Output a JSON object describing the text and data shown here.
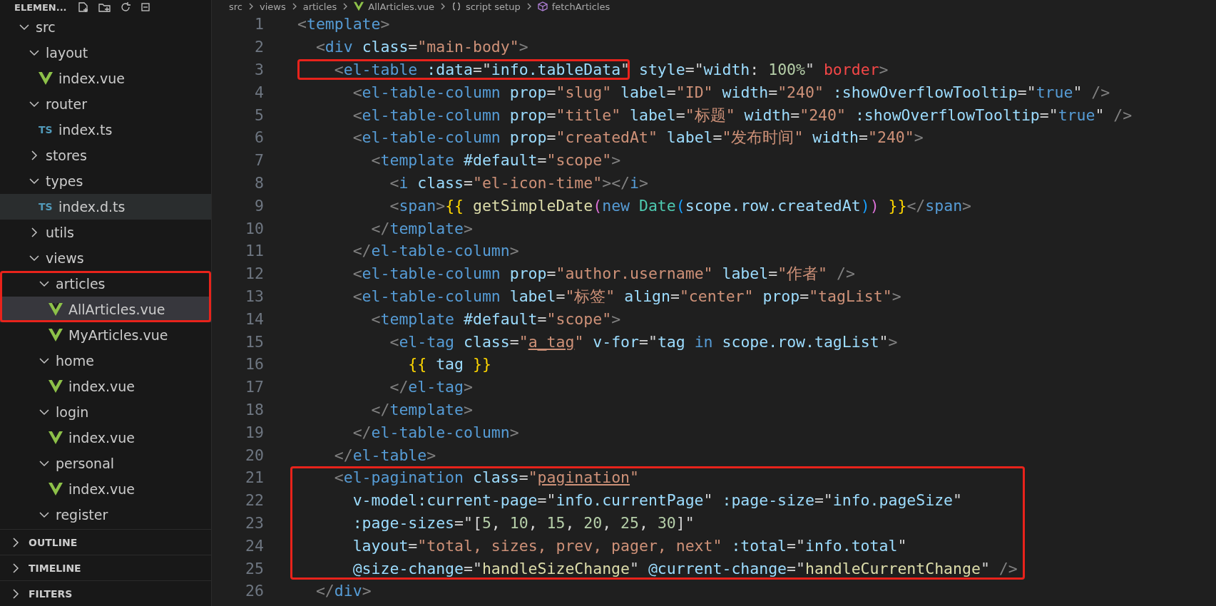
{
  "explorer": {
    "title": "ELEMEN...",
    "tree": [
      {
        "label": "src",
        "kind": "folder",
        "expanded": true,
        "selected": false,
        "hovered": false,
        "boxed": false,
        "children": [
          {
            "label": "layout",
            "kind": "folder",
            "expanded": true,
            "selected": false,
            "hovered": false,
            "boxed": false,
            "children": [
              {
                "label": "index.vue",
                "kind": "vue",
                "selected": false,
                "hovered": false,
                "boxed": false
              }
            ]
          },
          {
            "label": "router",
            "kind": "folder",
            "expanded": true,
            "selected": false,
            "hovered": false,
            "boxed": false,
            "children": [
              {
                "label": "index.ts",
                "kind": "ts",
                "icon_text": "TS",
                "selected": false,
                "hovered": false,
                "boxed": false
              }
            ]
          },
          {
            "label": "stores",
            "kind": "folder",
            "expanded": false,
            "selected": false,
            "hovered": false,
            "boxed": false
          },
          {
            "label": "types",
            "kind": "folder",
            "expanded": true,
            "selected": false,
            "hovered": false,
            "boxed": false,
            "children": [
              {
                "label": "index.d.ts",
                "kind": "ts",
                "icon_text": "TS",
                "selected": false,
                "hovered": true,
                "boxed": false
              }
            ]
          },
          {
            "label": "utils",
            "kind": "folder",
            "expanded": false,
            "selected": false,
            "hovered": false,
            "boxed": false
          },
          {
            "label": "views",
            "kind": "folder",
            "expanded": true,
            "selected": false,
            "hovered": false,
            "boxed": false,
            "children": [
              {
                "label": "articles",
                "kind": "folder",
                "expanded": true,
                "selected": false,
                "hovered": false,
                "boxed": true,
                "children": [
                  {
                    "label": "AllArticles.vue",
                    "kind": "vue",
                    "selected": true,
                    "hovered": false,
                    "boxed": true
                  },
                  {
                    "label": "MyArticles.vue",
                    "kind": "vue",
                    "selected": false,
                    "hovered": false,
                    "boxed": false
                  }
                ]
              },
              {
                "label": "home",
                "kind": "folder",
                "expanded": true,
                "selected": false,
                "hovered": false,
                "boxed": false,
                "children": [
                  {
                    "label": "index.vue",
                    "kind": "vue",
                    "selected": false,
                    "hovered": false,
                    "boxed": false
                  }
                ]
              },
              {
                "label": "login",
                "kind": "folder",
                "expanded": true,
                "selected": false,
                "hovered": false,
                "boxed": false,
                "children": [
                  {
                    "label": "index.vue",
                    "kind": "vue",
                    "selected": false,
                    "hovered": false,
                    "boxed": false
                  }
                ]
              },
              {
                "label": "personal",
                "kind": "folder",
                "expanded": true,
                "selected": false,
                "hovered": false,
                "boxed": false,
                "children": [
                  {
                    "label": "index.vue",
                    "kind": "vue",
                    "selected": false,
                    "hovered": false,
                    "boxed": false
                  }
                ]
              },
              {
                "label": "register",
                "kind": "folder",
                "expanded": true,
                "selected": false,
                "hovered": false,
                "boxed": false
              }
            ]
          }
        ]
      }
    ]
  },
  "panels": [
    {
      "label": "OUTLINE",
      "expanded": false
    },
    {
      "label": "TIMELINE",
      "expanded": false
    },
    {
      "label": "FILTERS",
      "expanded": false
    }
  ],
  "breadcrumb": [
    {
      "label": "src",
      "kind": "folder"
    },
    {
      "label": "views",
      "kind": "folder"
    },
    {
      "label": "articles",
      "kind": "folder"
    },
    {
      "label": "AllArticles.vue",
      "kind": "vue"
    },
    {
      "label": "script setup",
      "kind": "braces"
    },
    {
      "label": "fetchArticles",
      "kind": "method"
    }
  ],
  "code": {
    "lines": [
      {
        "number": "1",
        "boxed": false,
        "tokens": [
          {
            "kind": "p",
            "text": "<"
          },
          {
            "kind": "tag",
            "text": "template"
          },
          {
            "kind": "p",
            "text": ">"
          }
        ]
      },
      {
        "number": "2",
        "boxed": false,
        "tokens": [
          {
            "kind": "p",
            "text": "  <"
          },
          {
            "kind": "tag",
            "text": "div"
          },
          {
            "kind": "attr",
            "text": " class"
          },
          {
            "kind": "op",
            "text": "="
          },
          {
            "kind": "str",
            "text": "\"main-body\""
          },
          {
            "kind": "p",
            "text": ">"
          }
        ]
      },
      {
        "number": "3",
        "boxed": false,
        "tokens": [
          {
            "kind": "group",
            "boxed": true,
            "tokens": [
              {
                "kind": "p",
                "text": "    <"
              },
              {
                "kind": "tag",
                "text": "el-table"
              },
              {
                "kind": "attr",
                "text": " :data"
              },
              {
                "kind": "op",
                "text": "=\""
              },
              {
                "kind": "js",
                "text": "info.tableData"
              },
              {
                "kind": "op",
                "text": "\""
              }
            ]
          },
          {
            "kind": "attr",
            "text": " style"
          },
          {
            "kind": "op",
            "text": "=\""
          },
          {
            "kind": "cssp",
            "text": "width"
          },
          {
            "kind": "op",
            "text": ":"
          },
          {
            "kind": "num",
            "text": " 100%"
          },
          {
            "kind": "op",
            "text": "\""
          },
          {
            "kind": "err",
            "text": " border"
          },
          {
            "kind": "p",
            "text": ">"
          }
        ]
      },
      {
        "number": "4",
        "boxed": false,
        "tokens": [
          {
            "kind": "p",
            "text": "      <"
          },
          {
            "kind": "tag",
            "text": "el-table-column"
          },
          {
            "kind": "attr",
            "text": " prop"
          },
          {
            "kind": "op",
            "text": "="
          },
          {
            "kind": "str",
            "text": "\"slug\""
          },
          {
            "kind": "attr",
            "text": " label"
          },
          {
            "kind": "op",
            "text": "="
          },
          {
            "kind": "str",
            "text": "\"ID\""
          },
          {
            "kind": "attr",
            "text": " width"
          },
          {
            "kind": "op",
            "text": "="
          },
          {
            "kind": "str",
            "text": "\"240\""
          },
          {
            "kind": "attr",
            "text": " :showOverflowTooltip"
          },
          {
            "kind": "op",
            "text": "=\""
          },
          {
            "kind": "kw",
            "text": "true"
          },
          {
            "kind": "op",
            "text": "\""
          },
          {
            "kind": "p",
            "text": " />"
          }
        ]
      },
      {
        "number": "5",
        "boxed": false,
        "tokens": [
          {
            "kind": "p",
            "text": "      <"
          },
          {
            "kind": "tag",
            "text": "el-table-column"
          },
          {
            "kind": "attr",
            "text": " prop"
          },
          {
            "kind": "op",
            "text": "="
          },
          {
            "kind": "str",
            "text": "\"title\""
          },
          {
            "kind": "attr",
            "text": " label"
          },
          {
            "kind": "op",
            "text": "="
          },
          {
            "kind": "str",
            "text": "\"标题\""
          },
          {
            "kind": "attr",
            "text": " width"
          },
          {
            "kind": "op",
            "text": "="
          },
          {
            "kind": "str",
            "text": "\"240\""
          },
          {
            "kind": "attr",
            "text": " :showOverflowTooltip"
          },
          {
            "kind": "op",
            "text": "=\""
          },
          {
            "kind": "kw",
            "text": "true"
          },
          {
            "kind": "op",
            "text": "\""
          },
          {
            "kind": "p",
            "text": " />"
          }
        ]
      },
      {
        "number": "6",
        "boxed": false,
        "tokens": [
          {
            "kind": "p",
            "text": "      <"
          },
          {
            "kind": "tag",
            "text": "el-table-column"
          },
          {
            "kind": "attr",
            "text": " prop"
          },
          {
            "kind": "op",
            "text": "="
          },
          {
            "kind": "str",
            "text": "\"createdAt\""
          },
          {
            "kind": "attr",
            "text": " label"
          },
          {
            "kind": "op",
            "text": "="
          },
          {
            "kind": "str",
            "text": "\"发布时间\""
          },
          {
            "kind": "attr",
            "text": " width"
          },
          {
            "kind": "op",
            "text": "="
          },
          {
            "kind": "str",
            "text": "\"240\""
          },
          {
            "kind": "p",
            "text": ">"
          }
        ]
      },
      {
        "number": "7",
        "boxed": false,
        "tokens": [
          {
            "kind": "p",
            "text": "        <"
          },
          {
            "kind": "tag",
            "text": "template"
          },
          {
            "kind": "attr",
            "text": " #default"
          },
          {
            "kind": "op",
            "text": "="
          },
          {
            "kind": "str",
            "text": "\"scope\""
          },
          {
            "kind": "p",
            "text": ">"
          }
        ]
      },
      {
        "number": "8",
        "boxed": false,
        "tokens": [
          {
            "kind": "p",
            "text": "          <"
          },
          {
            "kind": "tag",
            "text": "i"
          },
          {
            "kind": "attr",
            "text": " class"
          },
          {
            "kind": "op",
            "text": "="
          },
          {
            "kind": "str",
            "text": "\"el-icon-time\""
          },
          {
            "kind": "p",
            "text": "></"
          },
          {
            "kind": "tag",
            "text": "i"
          },
          {
            "kind": "p",
            "text": ">"
          }
        ]
      },
      {
        "number": "9",
        "boxed": false,
        "tokens": [
          {
            "kind": "p",
            "text": "          <"
          },
          {
            "kind": "tag",
            "text": "span"
          },
          {
            "kind": "p",
            "text": ">"
          },
          {
            "kind": "brace",
            "text": "{{"
          },
          {
            "kind": "fn",
            "text": " getSimpleDate"
          },
          {
            "kind": "paren1",
            "text": "("
          },
          {
            "kind": "kw",
            "text": "new"
          },
          {
            "kind": "cls",
            "text": " Date"
          },
          {
            "kind": "paren2",
            "text": "("
          },
          {
            "kind": "js",
            "text": "scope.row.createdAt"
          },
          {
            "kind": "paren2",
            "text": ")"
          },
          {
            "kind": "paren1",
            "text": ")"
          },
          {
            "kind": "brace",
            "text": " }}"
          },
          {
            "kind": "p",
            "text": "</"
          },
          {
            "kind": "tag",
            "text": "span"
          },
          {
            "kind": "p",
            "text": ">"
          }
        ]
      },
      {
        "number": "10",
        "boxed": false,
        "tokens": [
          {
            "kind": "p",
            "text": "        </"
          },
          {
            "kind": "tag",
            "text": "template"
          },
          {
            "kind": "p",
            "text": ">"
          }
        ]
      },
      {
        "number": "11",
        "boxed": false,
        "tokens": [
          {
            "kind": "p",
            "text": "      </"
          },
          {
            "kind": "tag",
            "text": "el-table-column"
          },
          {
            "kind": "p",
            "text": ">"
          }
        ]
      },
      {
        "number": "12",
        "boxed": false,
        "tokens": [
          {
            "kind": "p",
            "text": "      <"
          },
          {
            "kind": "tag",
            "text": "el-table-column"
          },
          {
            "kind": "attr",
            "text": " prop"
          },
          {
            "kind": "op",
            "text": "="
          },
          {
            "kind": "str",
            "text": "\"author.username\""
          },
          {
            "kind": "attr",
            "text": " label"
          },
          {
            "kind": "op",
            "text": "="
          },
          {
            "kind": "str",
            "text": "\"作者\""
          },
          {
            "kind": "p",
            "text": " />"
          }
        ]
      },
      {
        "number": "13",
        "boxed": false,
        "tokens": [
          {
            "kind": "p",
            "text": "      <"
          },
          {
            "kind": "tag",
            "text": "el-table-column"
          },
          {
            "kind": "attr",
            "text": " label"
          },
          {
            "kind": "op",
            "text": "="
          },
          {
            "kind": "str",
            "text": "\"标签\""
          },
          {
            "kind": "attr",
            "text": " align"
          },
          {
            "kind": "op",
            "text": "="
          },
          {
            "kind": "str",
            "text": "\"center\""
          },
          {
            "kind": "attr",
            "text": " prop"
          },
          {
            "kind": "op",
            "text": "="
          },
          {
            "kind": "str",
            "text": "\"tagList\""
          },
          {
            "kind": "p",
            "text": ">"
          }
        ]
      },
      {
        "number": "14",
        "boxed": false,
        "tokens": [
          {
            "kind": "p",
            "text": "        <"
          },
          {
            "kind": "tag",
            "text": "template"
          },
          {
            "kind": "attr",
            "text": " #default"
          },
          {
            "kind": "op",
            "text": "="
          },
          {
            "kind": "str",
            "text": "\"scope\""
          },
          {
            "kind": "p",
            "text": ">"
          }
        ]
      },
      {
        "number": "15",
        "boxed": false,
        "tokens": [
          {
            "kind": "p",
            "text": "          <"
          },
          {
            "kind": "tag",
            "text": "el-tag"
          },
          {
            "kind": "attr",
            "text": " class"
          },
          {
            "kind": "op",
            "text": "="
          },
          {
            "kind": "str",
            "text": "\""
          },
          {
            "kind": "link",
            "text": "a_tag"
          },
          {
            "kind": "str",
            "text": "\""
          },
          {
            "kind": "attr",
            "text": " v-for"
          },
          {
            "kind": "op",
            "text": "=\""
          },
          {
            "kind": "js",
            "text": "tag"
          },
          {
            "kind": "kw",
            "text": " in"
          },
          {
            "kind": "js",
            "text": " scope.row.tagList"
          },
          {
            "kind": "op",
            "text": "\""
          },
          {
            "kind": "p",
            "text": ">"
          }
        ]
      },
      {
        "number": "16",
        "boxed": false,
        "tokens": [
          {
            "kind": "brace",
            "text": "            {{"
          },
          {
            "kind": "js",
            "text": " tag"
          },
          {
            "kind": "brace",
            "text": " }}"
          }
        ]
      },
      {
        "number": "17",
        "boxed": false,
        "tokens": [
          {
            "kind": "p",
            "text": "          </"
          },
          {
            "kind": "tag",
            "text": "el-tag"
          },
          {
            "kind": "p",
            "text": ">"
          }
        ]
      },
      {
        "number": "18",
        "boxed": false,
        "tokens": [
          {
            "kind": "p",
            "text": "        </"
          },
          {
            "kind": "tag",
            "text": "template"
          },
          {
            "kind": "p",
            "text": ">"
          }
        ]
      },
      {
        "number": "19",
        "boxed": false,
        "tokens": [
          {
            "kind": "p",
            "text": "      </"
          },
          {
            "kind": "tag",
            "text": "el-table-column"
          },
          {
            "kind": "p",
            "text": ">"
          }
        ]
      },
      {
        "number": "20",
        "boxed": false,
        "tokens": [
          {
            "kind": "p",
            "text": "    </"
          },
          {
            "kind": "tag",
            "text": "el-table"
          },
          {
            "kind": "p",
            "text": ">"
          }
        ]
      },
      {
        "number": "21",
        "boxed": true,
        "tokens": [
          {
            "kind": "p",
            "text": "    <"
          },
          {
            "kind": "tag",
            "text": "el-pagination"
          },
          {
            "kind": "attr",
            "text": " class"
          },
          {
            "kind": "op",
            "text": "="
          },
          {
            "kind": "str",
            "text": "\""
          },
          {
            "kind": "link",
            "text": "pagination"
          },
          {
            "kind": "str",
            "text": "\""
          }
        ]
      },
      {
        "number": "22",
        "boxed": true,
        "tokens": [
          {
            "kind": "attr",
            "text": "      v-model:current-page"
          },
          {
            "kind": "op",
            "text": "=\""
          },
          {
            "kind": "js",
            "text": "info.currentPage"
          },
          {
            "kind": "op",
            "text": "\""
          },
          {
            "kind": "attr",
            "text": " :page-size"
          },
          {
            "kind": "op",
            "text": "=\""
          },
          {
            "kind": "js",
            "text": "info.pageSize"
          },
          {
            "kind": "op",
            "text": "\""
          }
        ]
      },
      {
        "number": "23",
        "boxed": true,
        "tokens": [
          {
            "kind": "attr",
            "text": "      :page-sizes"
          },
          {
            "kind": "op",
            "text": "=\"["
          },
          {
            "kind": "num",
            "text": "5"
          },
          {
            "kind": "op",
            "text": ", "
          },
          {
            "kind": "num",
            "text": "10"
          },
          {
            "kind": "op",
            "text": ", "
          },
          {
            "kind": "num",
            "text": "15"
          },
          {
            "kind": "op",
            "text": ", "
          },
          {
            "kind": "num",
            "text": "20"
          },
          {
            "kind": "op",
            "text": ", "
          },
          {
            "kind": "num",
            "text": "25"
          },
          {
            "kind": "op",
            "text": ", "
          },
          {
            "kind": "num",
            "text": "30"
          },
          {
            "kind": "op",
            "text": "]\""
          }
        ]
      },
      {
        "number": "24",
        "boxed": true,
        "tokens": [
          {
            "kind": "attr",
            "text": "      layout"
          },
          {
            "kind": "op",
            "text": "="
          },
          {
            "kind": "str",
            "text": "\"total, sizes, prev, pager, next\""
          },
          {
            "kind": "attr",
            "text": " :total"
          },
          {
            "kind": "op",
            "text": "=\""
          },
          {
            "kind": "js",
            "text": "info.total"
          },
          {
            "kind": "op",
            "text": "\""
          }
        ]
      },
      {
        "number": "25",
        "boxed": true,
        "tokens": [
          {
            "kind": "attr",
            "text": "      @size-change"
          },
          {
            "kind": "op",
            "text": "=\""
          },
          {
            "kind": "fn",
            "text": "handleSizeChange"
          },
          {
            "kind": "op",
            "text": "\""
          },
          {
            "kind": "attr",
            "text": " @current-change"
          },
          {
            "kind": "op",
            "text": "=\""
          },
          {
            "kind": "fn",
            "text": "handleCurrentChange"
          },
          {
            "kind": "op",
            "text": "\""
          },
          {
            "kind": "p",
            "text": " />"
          }
        ]
      },
      {
        "number": "26",
        "boxed": false,
        "tokens": [
          {
            "kind": "p",
            "text": "  </"
          },
          {
            "kind": "tag",
            "text": "div"
          },
          {
            "kind": "p",
            "text": ">"
          }
        ]
      }
    ]
  }
}
